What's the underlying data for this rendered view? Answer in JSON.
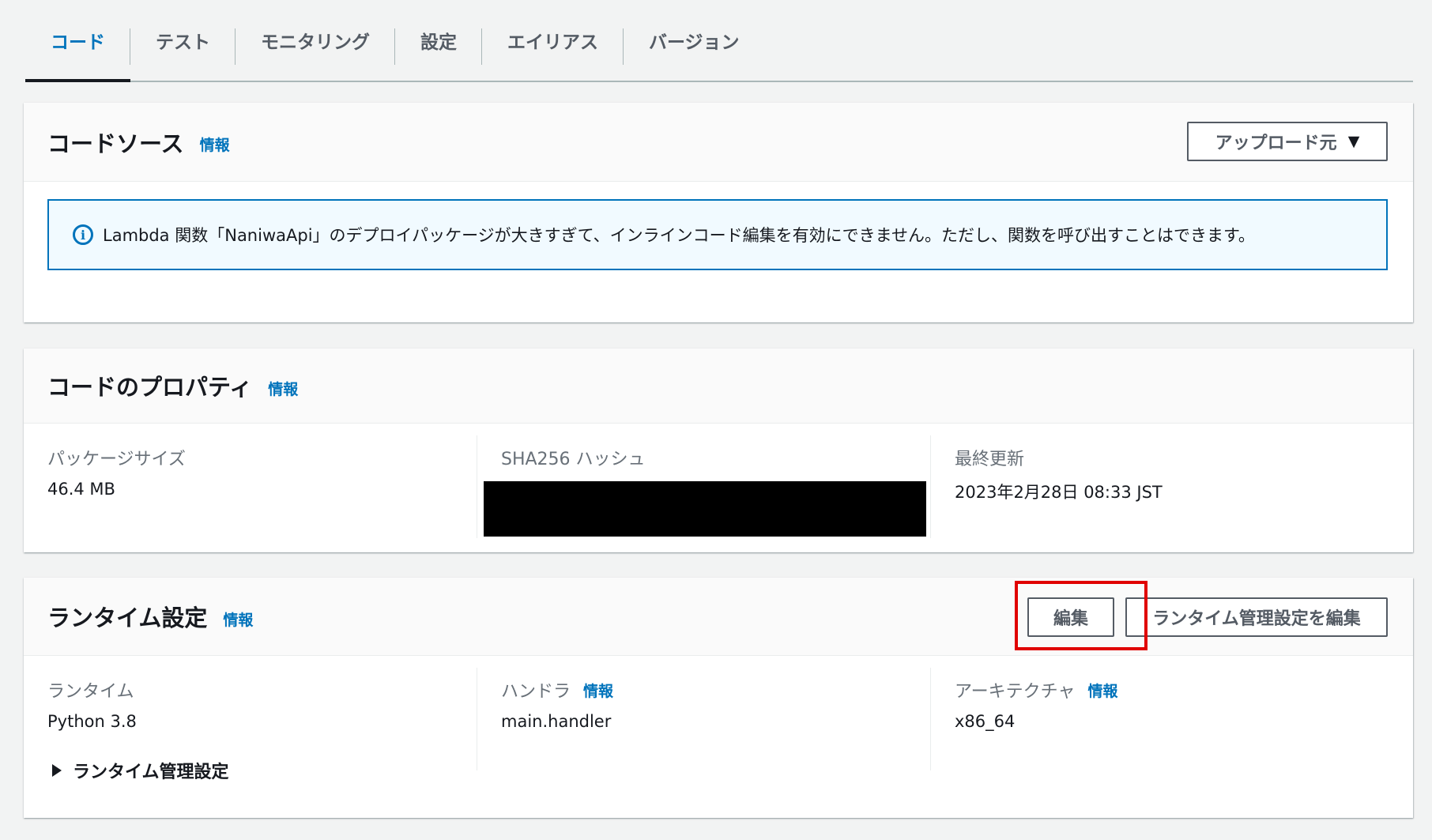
{
  "tabs": [
    {
      "label": "コード",
      "active": true
    },
    {
      "label": "テスト"
    },
    {
      "label": "モニタリング"
    },
    {
      "label": "設定"
    },
    {
      "label": "エイリアス"
    },
    {
      "label": "バージョン"
    }
  ],
  "code_source": {
    "title": "コードソース",
    "info": "情報",
    "upload_button": "アップロード元",
    "alert": "Lambda 関数「NaniwaApi」のデプロイパッケージが大きすぎて、インラインコード編集を有効にできません。ただし、関数を呼び出すことはできます。"
  },
  "code_properties": {
    "title": "コードのプロパティ",
    "info": "情報",
    "package_size_label": "パッケージサイズ",
    "package_size_value": "46.4 MB",
    "sha_label": "SHA256 ハッシュ",
    "last_modified_label": "最終更新",
    "last_modified_value": "2023年2月28日 08:33 JST"
  },
  "runtime_settings": {
    "title": "ランタイム設定",
    "info": "情報",
    "edit_button": "編集",
    "edit_runtime_mgmt_button": "ランタイム管理設定を編集",
    "runtime_label": "ランタイム",
    "runtime_value": "Python 3.8",
    "handler_label": "ハンドラ",
    "handler_info": "情報",
    "handler_value": "main.handler",
    "arch_label": "アーキテクチャ",
    "arch_info": "情報",
    "arch_value": "x86_64",
    "runtime_mgmt_expander": "ランタイム管理設定"
  },
  "colors": {
    "accent": "#0073bb",
    "highlight": "#e00000",
    "background": "#f2f3f3"
  },
  "icons": {
    "info": "info-circle-icon",
    "dropdown": "caret-down-icon",
    "expand": "caret-right-icon"
  }
}
